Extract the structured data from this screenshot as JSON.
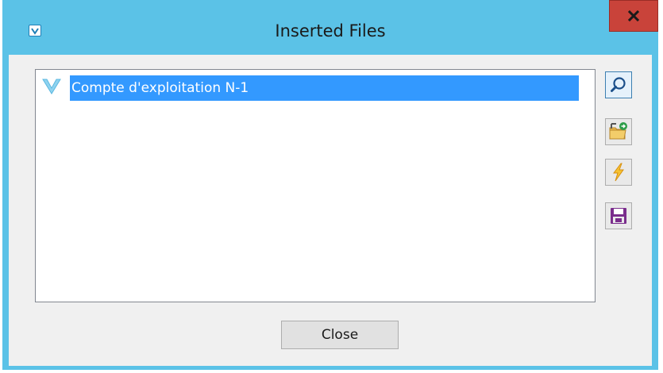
{
  "window": {
    "title": "Inserted Files",
    "close_glyph": "x"
  },
  "files": {
    "items": [
      {
        "label": "Compte d'exploitation N-1",
        "selected": true,
        "icon": "v-logo-icon"
      }
    ]
  },
  "toolbar": {
    "buttons": [
      {
        "name": "search-button",
        "icon": "magnifier-icon"
      },
      {
        "name": "import-button",
        "icon": "folder-import-icon"
      },
      {
        "name": "run-button",
        "icon": "lightning-icon"
      },
      {
        "name": "save-button",
        "icon": "floppy-disk-icon"
      }
    ]
  },
  "footer": {
    "close_label": "Close"
  },
  "colors": {
    "titlebar": "#5bc2e7",
    "close_box": "#c9433a",
    "selection": "#3399ff",
    "client": "#f0f0f0"
  }
}
